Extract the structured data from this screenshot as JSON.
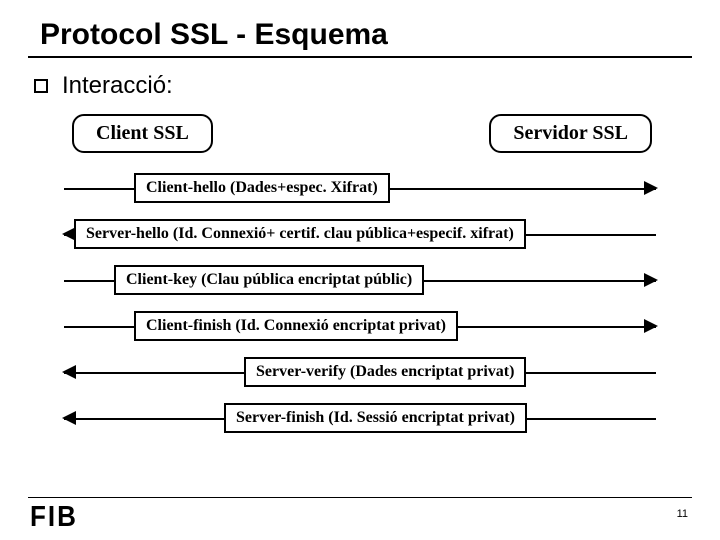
{
  "title": "Protocol SSL - Esquema",
  "bullet": "Interacció:",
  "actors": {
    "client": "Client SSL",
    "server": "Servidor SSL"
  },
  "messages": [
    {
      "label": "Client-hello (Dades+espec. Xifrat)",
      "direction": "right",
      "offset": 70
    },
    {
      "label": "Server-hello (Id. Connexió+ certif. clau pública+especif. xifrat)",
      "direction": "left",
      "offset": 10
    },
    {
      "label": "Client-key (Clau pública encriptat públic)",
      "direction": "right",
      "offset": 50
    },
    {
      "label": "Client-finish (Id. Connexió encriptat privat)",
      "direction": "right",
      "offset": 70
    },
    {
      "label": "Server-verify (Dades encriptat privat)",
      "direction": "left",
      "offset": 180
    },
    {
      "label": "Server-finish (Id. Sessió encriptat privat)",
      "direction": "left",
      "offset": 160
    }
  ],
  "logo": "FIB",
  "page": "11"
}
